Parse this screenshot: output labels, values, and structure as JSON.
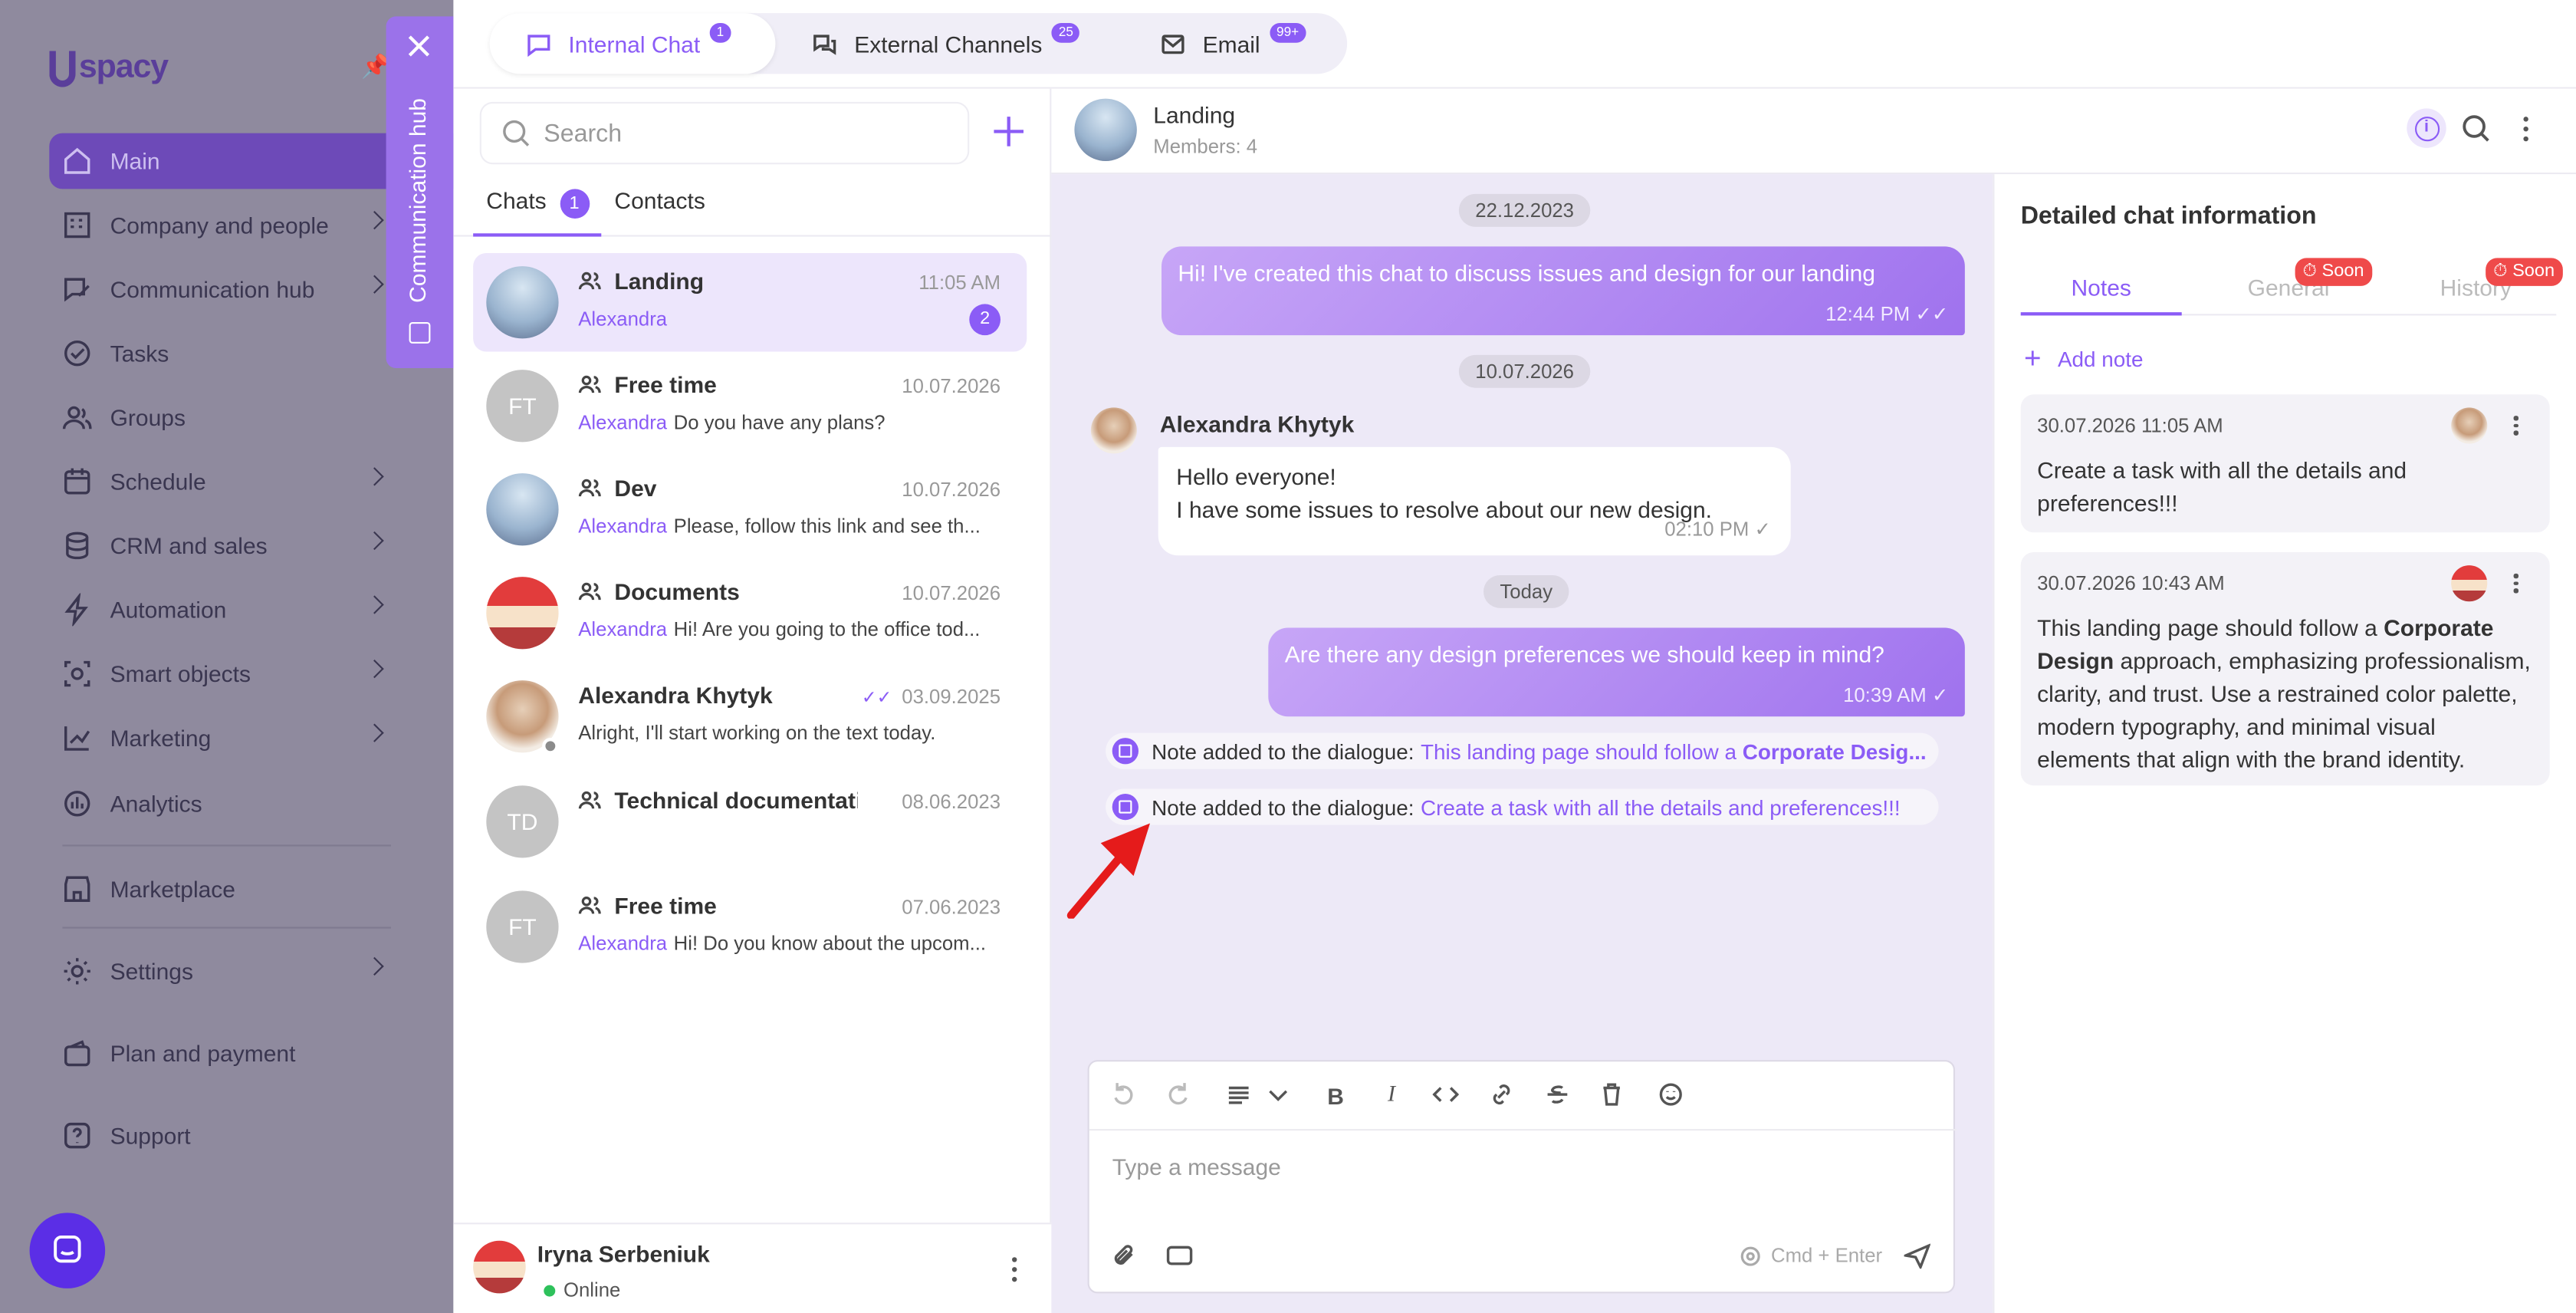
{
  "sidebar": {
    "logo": "spacy",
    "items": [
      {
        "label": "Main"
      },
      {
        "label": "Company and people"
      },
      {
        "label": "Communication hub"
      },
      {
        "label": "Tasks"
      },
      {
        "label": "Groups"
      },
      {
        "label": "Schedule"
      },
      {
        "label": "CRM and sales"
      },
      {
        "label": "Automation"
      },
      {
        "label": "Smart objects"
      },
      {
        "label": "Marketing"
      },
      {
        "label": "Analytics"
      },
      {
        "label": "Marketplace"
      },
      {
        "label": "Settings"
      },
      {
        "label": "Plan and payment"
      },
      {
        "label": "Support"
      }
    ]
  },
  "hub_tab": {
    "label": "Communication hub"
  },
  "top_tabs": [
    {
      "label": "Internal Chat",
      "badge": "1"
    },
    {
      "label": "External Channels",
      "badge": "25"
    },
    {
      "label": "Email",
      "badge": "99+"
    }
  ],
  "chatlist": {
    "search_placeholder": "Search",
    "tabs": {
      "chats": "Chats",
      "chats_count": "1",
      "contacts": "Contacts"
    },
    "chats": [
      {
        "title": "Landing",
        "time": "11:05 AM",
        "sender": "Alexandra",
        "preview": "",
        "unread": "2"
      },
      {
        "title": "Free time",
        "time": "10.07.2026",
        "sender": "Alexandra",
        "preview": "Do you have any plans?",
        "initials": "FT"
      },
      {
        "title": "Dev",
        "time": "10.07.2026",
        "sender": "Alexandra",
        "preview": "Please, follow this link and see th..."
      },
      {
        "title": "Documents",
        "time": "10.07.2026",
        "sender": "Alexandra",
        "preview": "Hi! Are you going to the office tod..."
      },
      {
        "title": "Alexandra Khytyk",
        "time": "03.09.2025",
        "sender": "",
        "preview": "Alright, I'll start working on the text today."
      },
      {
        "title": "Technical documentati...",
        "time": "08.06.2023",
        "sender": "",
        "preview": "",
        "initials": "TD"
      },
      {
        "title": "Free time",
        "time": "07.06.2023",
        "sender": "Alexandra",
        "preview": "Hi! Do you know about the upcom...",
        "initials": "FT"
      }
    ],
    "current_user": {
      "name": "Iryna Serbeniuk",
      "status": "Online"
    }
  },
  "chat": {
    "title": "Landing",
    "members": "Members: 4",
    "dates": [
      "22.12.2023",
      "10.07.2026",
      "Today"
    ],
    "messages": [
      {
        "text": "Hi! I've created this chat to discuss issues and design for our landing",
        "time": "12:44 PM"
      },
      {
        "sender": "Alexandra Khytyk",
        "line1": "Hello everyone!",
        "line2": "I have some issues to resolve about our new design.",
        "time": "02:10 PM"
      },
      {
        "text": "Are there any design preferences we should keep in mind?",
        "time": "10:39 AM"
      }
    ],
    "notes": [
      {
        "prefix": "Note added to the dialogue:",
        "link": "This landing page should follow a ",
        "link_bold": "Corporate Desig..."
      },
      {
        "prefix": "Note added to the dialogue:",
        "link": "Create a task with all the details and preferences!!!"
      }
    ],
    "composer": {
      "placeholder": "Type a message",
      "send_hint": "Cmd + Enter"
    }
  },
  "details": {
    "title": "Detailed chat information",
    "tabs": [
      {
        "label": "Notes"
      },
      {
        "label": "General",
        "badge": "Soon"
      },
      {
        "label": "History",
        "badge": "Soon"
      }
    ],
    "add_note": "Add note",
    "notes": [
      {
        "date": "30.07.2026 11:05 AM",
        "text": "Create a task with all the details and preferences!!!"
      },
      {
        "date": "30.07.2026 10:43 AM",
        "t1": "This landing page should follow a ",
        "b1": "Corporate Design",
        "t2": " approach, emphasizing professionalism, clarity, and trust. Use a restrained color palette, modern typography, and minimal visual elements that align with the brand identity."
      }
    ]
  },
  "colors": {
    "accent": "#8b5cf6",
    "soon": "#ef4a4a",
    "online": "#2ec15b"
  }
}
